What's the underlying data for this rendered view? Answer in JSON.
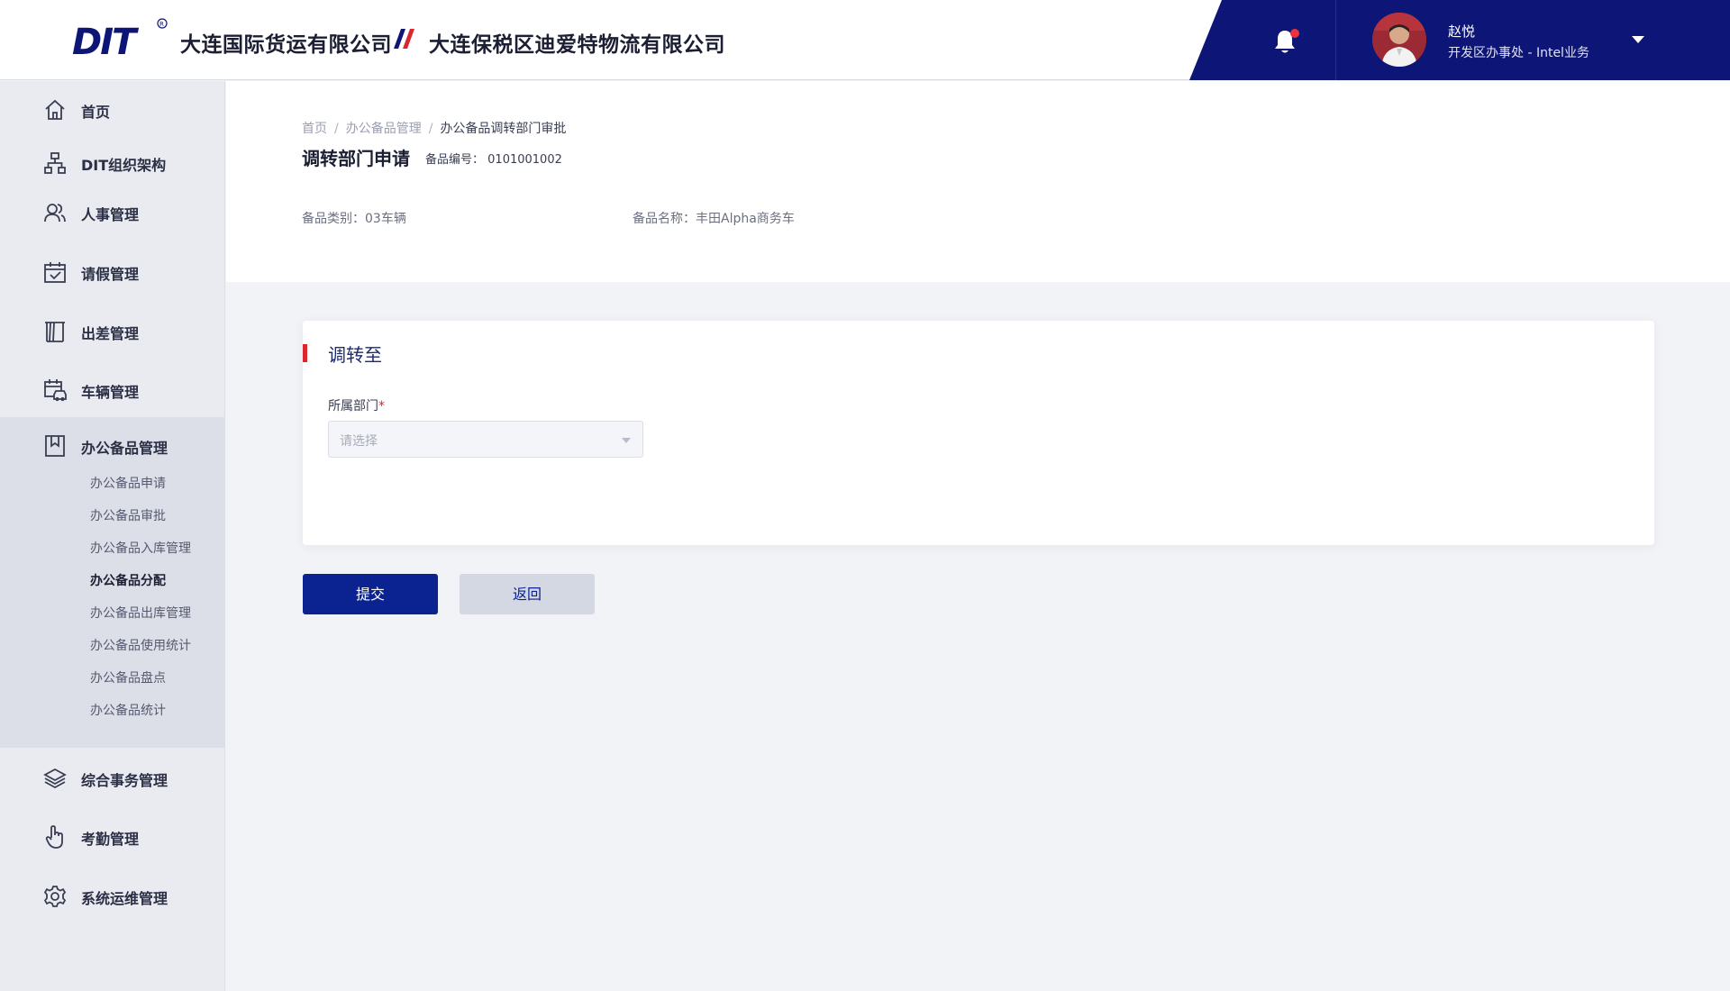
{
  "header": {
    "logo_text": "DIT",
    "company_1": "大连国际货运有限公司",
    "company_2": "大连保税区迪爱特物流有限公司",
    "user_name": "赵悦",
    "user_dept": "开发区办事处 - Intel业务",
    "brand_color": "#0d1676",
    "notification_dot_color": "#e8333e"
  },
  "sidebar": {
    "items": [
      {
        "label": "首页",
        "icon": "home-icon"
      },
      {
        "label": "DIT组织架构",
        "icon": "org-chart-icon"
      },
      {
        "label": "人事管理",
        "icon": "users-icon"
      },
      {
        "label": "请假管理",
        "icon": "calendar-check-icon"
      },
      {
        "label": "出差管理",
        "icon": "travel-icon"
      },
      {
        "label": "车辆管理",
        "icon": "vehicle-calendar-icon"
      },
      {
        "label": "办公备品管理",
        "icon": "bookmark-icon"
      },
      {
        "label": "综合事务管理",
        "icon": "layers-icon"
      },
      {
        "label": "考勤管理",
        "icon": "hand-pointer-icon"
      },
      {
        "label": "系统运维管理",
        "icon": "gear-icon"
      }
    ],
    "sub_items": [
      "办公备品申请",
      "办公备品审批",
      "办公备品入库管理",
      "办公备品分配",
      "办公备品出库管理",
      "办公备品使用统计",
      "办公备品盘点",
      "办公备品统计"
    ],
    "active_sub_item": "办公备品分配"
  },
  "breadcrumb": [
    "首页",
    "办公备品管理",
    "办公备品调转部门审批"
  ],
  "page": {
    "title": "调转部门申请",
    "code_label": "备品编号：",
    "code_value": "0101001002",
    "category": "备品类别：03车辆",
    "name": "备品名称：丰田Alpha商务车"
  },
  "form": {
    "section_title": "调转至",
    "dept_label": "所属部门",
    "required_mark": "*",
    "dept_placeholder": "请选择",
    "dept_value": ""
  },
  "buttons": {
    "submit": "提交",
    "back": "返回"
  },
  "colors": {
    "accent_red": "#d9262f",
    "primary_button": "#0a2390"
  }
}
